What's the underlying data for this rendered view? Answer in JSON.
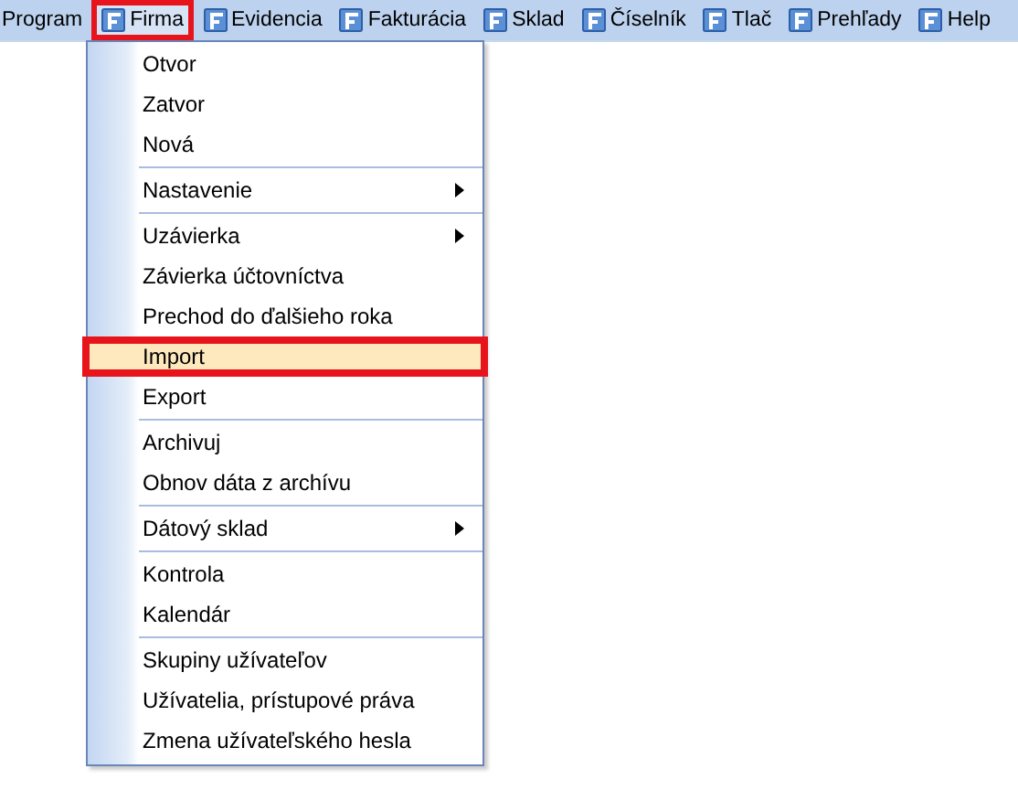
{
  "menubar": [
    {
      "label": "Program",
      "icon": false,
      "selected": false,
      "marked": false
    },
    {
      "label": "Firma",
      "icon": true,
      "selected": true,
      "marked": true
    },
    {
      "label": "Evidencia",
      "icon": true,
      "selected": false,
      "marked": false
    },
    {
      "label": "Fakturácia",
      "icon": true,
      "selected": false,
      "marked": false
    },
    {
      "label": "Sklad",
      "icon": true,
      "selected": false,
      "marked": false
    },
    {
      "label": "Číselník",
      "icon": true,
      "selected": false,
      "marked": false
    },
    {
      "label": "Tlač",
      "icon": true,
      "selected": false,
      "marked": false
    },
    {
      "label": "Prehľady",
      "icon": true,
      "selected": false,
      "marked": false
    },
    {
      "label": "Help",
      "icon": true,
      "selected": false,
      "marked": false
    }
  ],
  "menu": {
    "groups": [
      [
        {
          "label": "Otvor",
          "submenu": false,
          "selected": false,
          "marked": false
        },
        {
          "label": "Zatvor",
          "submenu": false,
          "selected": false,
          "marked": false
        },
        {
          "label": "Nová",
          "submenu": false,
          "selected": false,
          "marked": false
        }
      ],
      [
        {
          "label": "Nastavenie",
          "submenu": true,
          "selected": false,
          "marked": false
        }
      ],
      [
        {
          "label": "Uzávierka",
          "submenu": true,
          "selected": false,
          "marked": false
        },
        {
          "label": "Závierka účtovníctva",
          "submenu": false,
          "selected": false,
          "marked": false
        },
        {
          "label": "Prechod do ďalšieho roka",
          "submenu": false,
          "selected": false,
          "marked": false
        },
        {
          "label": "Import",
          "submenu": false,
          "selected": true,
          "marked": true
        },
        {
          "label": "Export",
          "submenu": false,
          "selected": false,
          "marked": false
        }
      ],
      [
        {
          "label": "Archivuj",
          "submenu": false,
          "selected": false,
          "marked": false
        },
        {
          "label": "Obnov dáta z archívu",
          "submenu": false,
          "selected": false,
          "marked": false
        }
      ],
      [
        {
          "label": "Dátový sklad",
          "submenu": true,
          "selected": false,
          "marked": false
        }
      ],
      [
        {
          "label": "Kontrola",
          "submenu": false,
          "selected": false,
          "marked": false
        },
        {
          "label": "Kalendár",
          "submenu": false,
          "selected": false,
          "marked": false
        }
      ],
      [
        {
          "label": "Skupiny užívateľov",
          "submenu": false,
          "selected": false,
          "marked": false
        },
        {
          "label": "Užívatelia,  prístupové práva",
          "submenu": false,
          "selected": false,
          "marked": false
        },
        {
          "label": "Zmena užívateľského hesla",
          "submenu": false,
          "selected": false,
          "marked": false
        }
      ]
    ]
  }
}
